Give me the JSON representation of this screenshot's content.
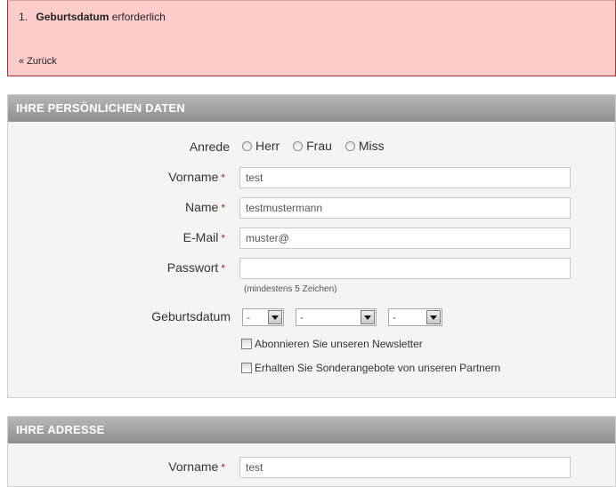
{
  "error": {
    "number": "1.",
    "field": "Geburtsdatum",
    "message": "erforderlich",
    "back_link": "« Zurück"
  },
  "personal": {
    "header": "IHRE PERSÖNLICHEN DATEN",
    "salutation": {
      "label": "Anrede",
      "options": [
        "Herr",
        "Frau",
        "Miss"
      ]
    },
    "firstname": {
      "label": "Vorname",
      "required_mark": "*",
      "value": "test"
    },
    "lastname": {
      "label": "Name",
      "required_mark": "*",
      "value": "testmustermann"
    },
    "email": {
      "label": "E-Mail",
      "required_mark": "*",
      "value": "muster@"
    },
    "password": {
      "label": "Passwort",
      "required_mark": "*",
      "value": "",
      "hint": "(mindestens 5 Zeichen)"
    },
    "birthdate": {
      "label": "Geburtsdatum",
      "day": "-",
      "month": "-",
      "year": "-"
    },
    "newsletter_label": "Abonnieren Sie unseren Newsletter",
    "partner_offers_label": "Erhalten Sie Sonderangebote von unseren Partnern"
  },
  "address": {
    "header": "IHRE ADRESSE",
    "firstname": {
      "label": "Vorname",
      "required_mark": "*",
      "value": "test"
    }
  }
}
